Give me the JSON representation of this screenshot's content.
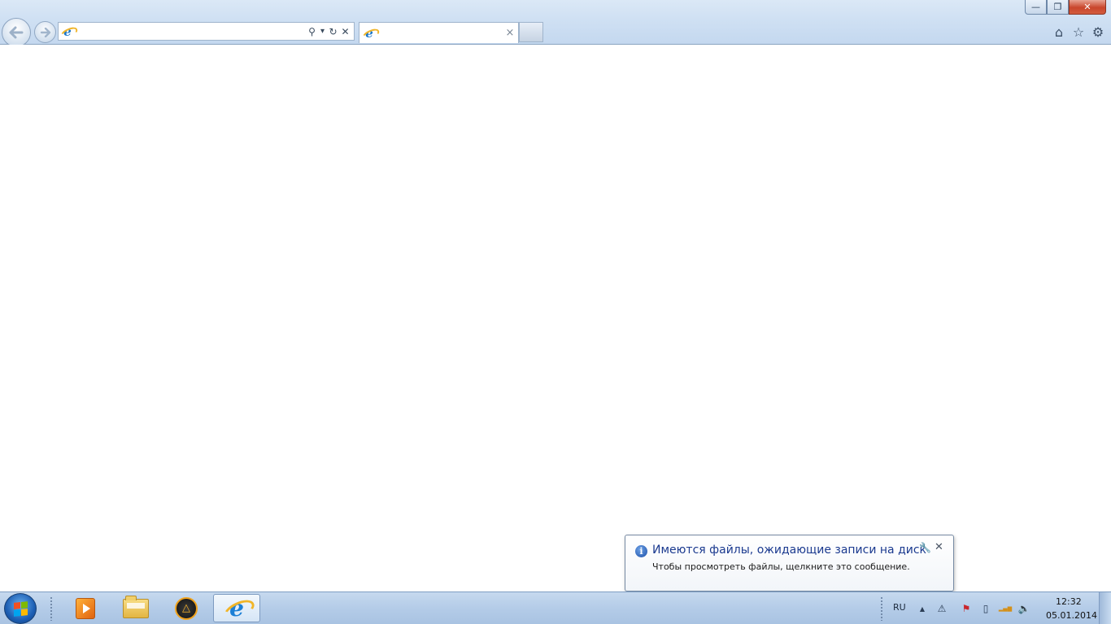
{
  "window": {
    "minimize_glyph": "—",
    "maximize_glyph": "❐",
    "close_glyph": "✕"
  },
  "toolbar": {
    "back_icon": "back-arrow-icon",
    "forward_icon": "forward-arrow-icon",
    "address": {
      "value": "",
      "placeholder": "",
      "site_icon": "ie-page-icon",
      "search_glyph": "⚲",
      "dropdown_glyph": "▾",
      "refresh_glyph": "↻",
      "stop_glyph": "✕"
    },
    "right": {
      "home_glyph": "⌂",
      "favorites_glyph": "☆",
      "tools_glyph": "⚙"
    }
  },
  "tabs": [
    {
      "title": "",
      "close_glyph": "×",
      "active": true
    }
  ],
  "notification": {
    "info_glyph": "i",
    "title": "Имеются файлы, ожидающие записи на диск",
    "text": "Чтобы просмотреть файлы, щелкните это сообщение.",
    "wrench_glyph": "🔧",
    "close_glyph": "✕"
  },
  "taskbar": {
    "start_flag_colors": [
      "#f25022",
      "#7fba00",
      "#00a4ef",
      "#ffb900"
    ],
    "pinned": [
      {
        "name": "windows-media-player",
        "icon": "wmp-icon"
      },
      {
        "name": "windows-explorer",
        "icon": "folder-icon"
      },
      {
        "name": "aimp",
        "icon": "aimp-icon",
        "glyph": "△"
      },
      {
        "name": "internet-explorer",
        "icon": "ie-icon",
        "glyph": "e",
        "active": true
      }
    ],
    "tray": {
      "language": "RU",
      "show_hidden_glyph": "▲",
      "pending_files_glyph": "⚠",
      "action_center_glyph": "⚑",
      "battery_glyph": "▯",
      "network_glyph": "▂▄▆",
      "volume_glyph": "🔈"
    },
    "clock": {
      "time": "12:32",
      "date": "05.01.2014"
    }
  },
  "colors": {
    "notification_title": "#1b3a8f",
    "close_button": "#c9462c",
    "taskbar": "#b4cce8"
  }
}
